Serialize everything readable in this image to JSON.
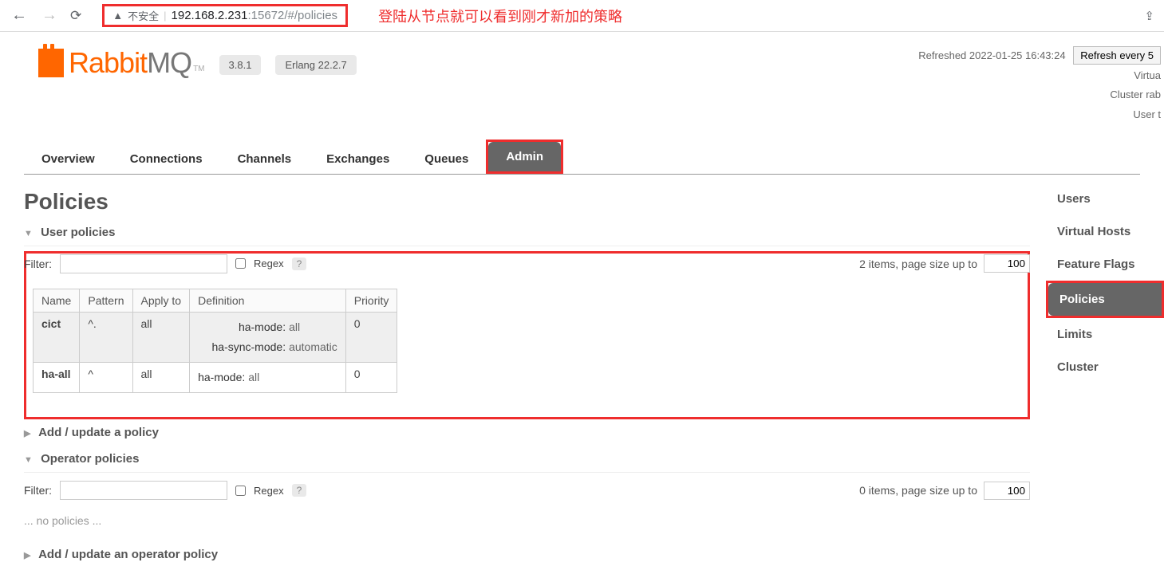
{
  "browser": {
    "insecure_label": "不安全",
    "url_host": "192.168.2.231",
    "url_rest": ":15672/#/policies",
    "annotation": "登陆从节点就可以看到刚才新加的策略"
  },
  "header": {
    "logo_a": "Rabbit",
    "logo_b": "MQ",
    "tm": "TM",
    "version": "3.8.1",
    "erlang": "Erlang 22.2.7"
  },
  "status": {
    "refreshed": "Refreshed 2022-01-25 16:43:24",
    "refresh_btn": "Refresh every 5",
    "virtual": "Virtua",
    "cluster": "Cluster rab",
    "user": "User t"
  },
  "tabs": {
    "overview": "Overview",
    "connections": "Connections",
    "channels": "Channels",
    "exchanges": "Exchanges",
    "queues": "Queues",
    "admin": "Admin"
  },
  "page": {
    "title": "Policies",
    "user_policies": "User policies",
    "add_policy": "Add / update a policy",
    "operator_policies": "Operator policies",
    "add_operator": "Add / update an operator policy",
    "no_policies": "... no policies ..."
  },
  "filter": {
    "label": "Filter:",
    "regex": "Regex",
    "q": "?",
    "count1": "2 items, page size up to",
    "count2": "0 items, page size up to",
    "page_size": "100"
  },
  "table": {
    "h_name": "Name",
    "h_pattern": "Pattern",
    "h_apply": "Apply to",
    "h_def": "Definition",
    "h_prio": "Priority",
    "rows": [
      {
        "name": "cict",
        "pattern": "^.",
        "apply": "all",
        "def": [
          {
            "k": "ha-mode:",
            "v": "all"
          },
          {
            "k": "ha-sync-mode:",
            "v": "automatic"
          }
        ],
        "prio": "0"
      },
      {
        "name": "ha-all",
        "pattern": "^",
        "apply": "all",
        "def": [
          {
            "k": "ha-mode:",
            "v": "all"
          }
        ],
        "prio": "0"
      }
    ]
  },
  "sidebar": {
    "users": "Users",
    "vhosts": "Virtual Hosts",
    "flags": "Feature Flags",
    "policies": "Policies",
    "limits": "Limits",
    "cluster": "Cluster"
  }
}
